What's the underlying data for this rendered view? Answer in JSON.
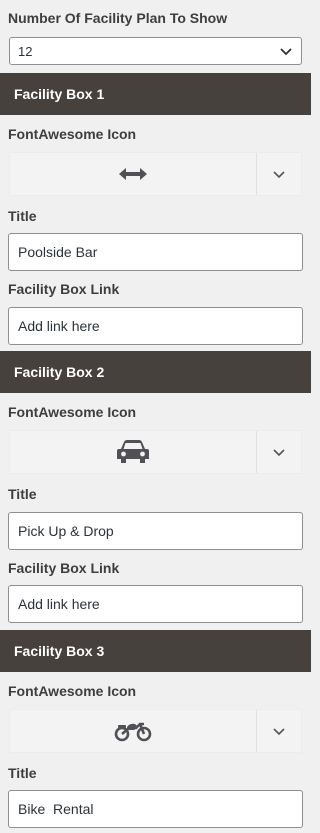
{
  "plan_count": {
    "label": "Number Of Facility Plan To Show",
    "value": "12"
  },
  "boxes": [
    {
      "header": "Facility Box 1",
      "icon_label": "FontAwesome Icon",
      "icon_name": "arrows-horizontal-icon",
      "title_label": "Title",
      "title_value": "Poolside Bar",
      "link_label": "Facility Box Link",
      "link_value": "Add link here"
    },
    {
      "header": "Facility Box 2",
      "icon_label": "FontAwesome Icon",
      "icon_name": "car-icon",
      "title_label": "Title",
      "title_value": "Pick Up & Drop",
      "link_label": "Facility Box Link",
      "link_value": "Add link here"
    },
    {
      "header": "Facility Box 3",
      "icon_label": "FontAwesome Icon",
      "icon_name": "motorcycle-icon",
      "title_label": "Title",
      "title_value": "Bike  Rental"
    }
  ],
  "colors": {
    "header_bg": "#46413c",
    "panel_bg": "#f0f0f1",
    "icon_color": "#505055"
  }
}
